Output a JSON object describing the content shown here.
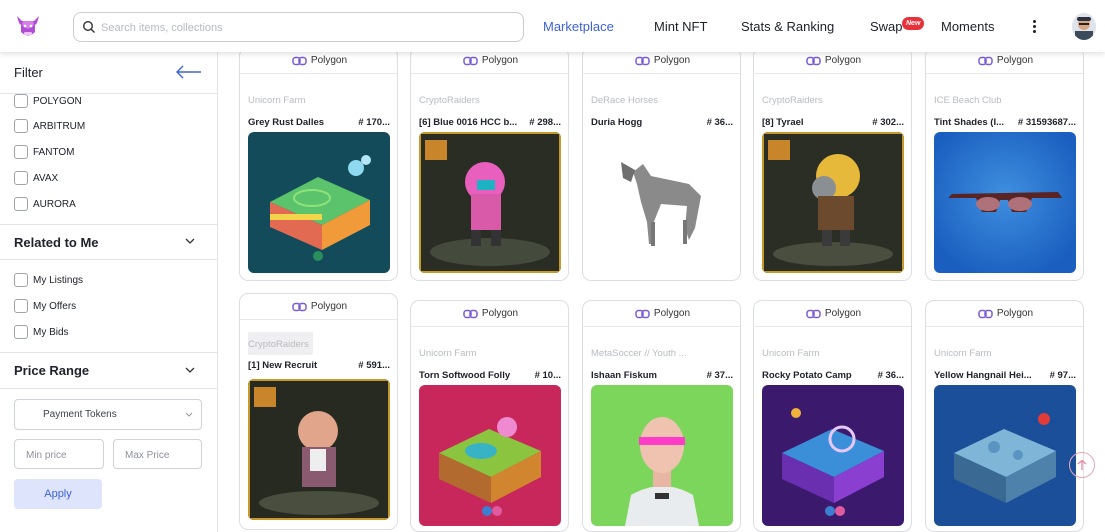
{
  "header": {
    "search_placeholder": "Search items, collections",
    "nav": [
      "Marketplace",
      "Mint NFT",
      "Stats & Ranking",
      "Swap",
      "Moments"
    ],
    "new_badge": "New",
    "accent": "#3d62d6",
    "badge_color": "#e8313a"
  },
  "sidebar": {
    "filter_title": "Filter",
    "chains": [
      "POLYGON",
      "ARBITRUM",
      "FANTOM",
      "AVAX",
      "AURORA"
    ],
    "related_title": "Related to Me",
    "related": [
      "My Listings",
      "My Offers",
      "My Bids"
    ],
    "price_title": "Price Range",
    "payment_tokens": "Payment Tokens",
    "min_price": "Min price",
    "max_price": "Max Price",
    "apply": "Apply"
  },
  "cards": [
    {
      "chain": "Polygon",
      "collection": "Unicorn Farm",
      "name": "Grey Rust Dalles",
      "num": "# 170..."
    },
    {
      "chain": "Polygon",
      "collection": "CryptoRaiders",
      "name": "[6] Blue 0016 HCC b...",
      "num": "# 298..."
    },
    {
      "chain": "Polygon",
      "collection": "DeRace Horses",
      "name": "Duria Hogg",
      "num": "# 36..."
    },
    {
      "chain": "Polygon",
      "collection": "CryptoRaiders",
      "name": "[8] Tyrael",
      "num": "# 302..."
    },
    {
      "chain": "Polygon",
      "collection": "ICE Beach Club",
      "name": "Tint Shades (I...",
      "num": "# 31593687..."
    },
    {
      "chain": "Polygon",
      "collection": "CryptoRaiders",
      "name": "[1] New Recruit",
      "num": "# 591..."
    },
    {
      "chain": "Polygon",
      "collection": "Unicorn Farm",
      "name": "Torn Softwood Folly",
      "num": "# 10..."
    },
    {
      "chain": "Polygon",
      "collection": "MetaSoccer // Youth ...",
      "name": "Ishaan Fiskum",
      "num": "# 37..."
    },
    {
      "chain": "Polygon",
      "collection": "Unicorn Farm",
      "name": "Rocky Potato Camp",
      "num": "# 36..."
    },
    {
      "chain": "Polygon",
      "collection": "Unicorn Farm",
      "name": "Yellow Hangnail Hei...",
      "num": "# 97..."
    }
  ]
}
